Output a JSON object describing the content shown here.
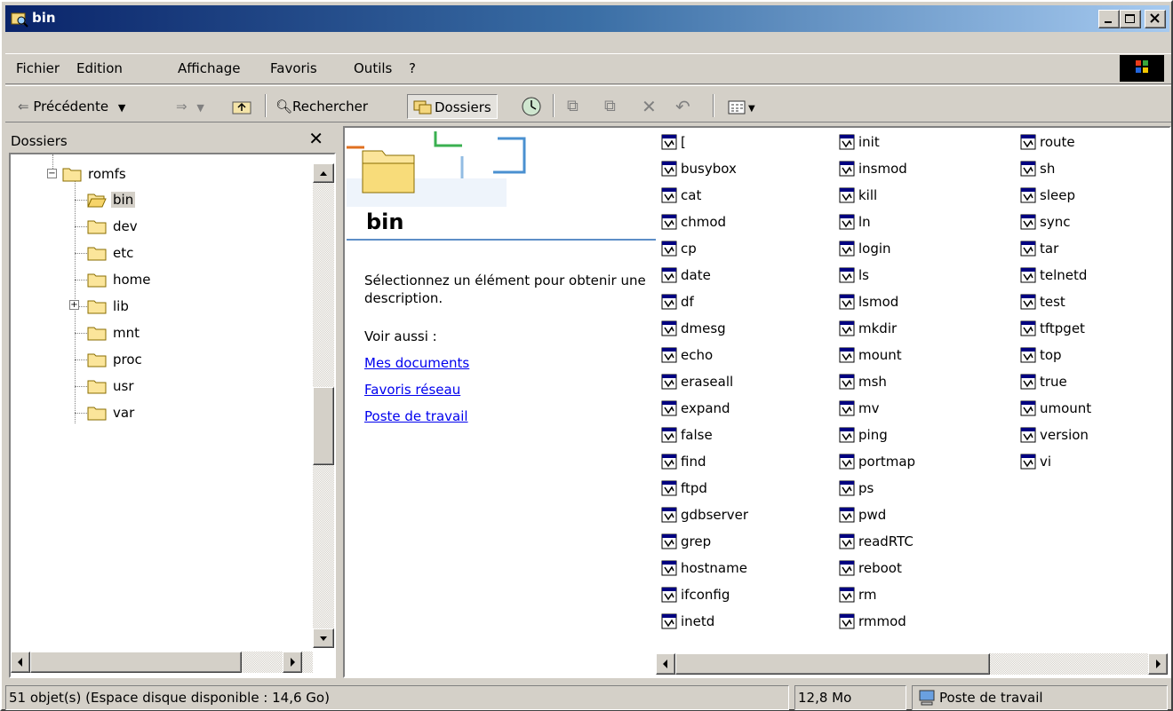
{
  "window": {
    "title": "bin"
  },
  "menu": [
    "Fichier",
    "Edition",
    "Affichage",
    "Favoris",
    "Outils",
    "?"
  ],
  "toolbar": {
    "back_label": "Précédente",
    "search_label": "Rechercher",
    "folders_label": "Dossiers"
  },
  "left_pane": {
    "header": "Dossiers",
    "tree": [
      {
        "label": "romfs",
        "expanded": true
      },
      {
        "label": "bin",
        "selected": true
      },
      {
        "label": "dev"
      },
      {
        "label": "etc"
      },
      {
        "label": "home"
      },
      {
        "label": "lib",
        "collapsed": true
      },
      {
        "label": "mnt"
      },
      {
        "label": "proc"
      },
      {
        "label": "usr"
      },
      {
        "label": "var"
      }
    ]
  },
  "webview": {
    "folder_title": "bin",
    "description": "Sélectionnez un élément pour obtenir une description.",
    "see_also": "Voir aussi :",
    "links": [
      "Mes documents",
      "Favoris réseau",
      "Poste de travail"
    ]
  },
  "files": {
    "col1": [
      "[",
      "busybox",
      "cat",
      "chmod",
      "cp",
      "date",
      "df",
      "dmesg",
      "echo",
      "eraseall",
      "expand",
      "false",
      "find",
      "ftpd",
      "gdbserver",
      "grep",
      "hostname",
      "ifconfig",
      "inetd"
    ],
    "col2": [
      "init",
      "insmod",
      "kill",
      "ln",
      "login",
      "ls",
      "lsmod",
      "mkdir",
      "mount",
      "msh",
      "mv",
      "ping",
      "portmap",
      "ps",
      "pwd",
      "readRTC",
      "reboot",
      "rm",
      "rmmod"
    ],
    "col3": [
      "route",
      "sh",
      "sleep",
      "sync",
      "tar",
      "telnetd",
      "test",
      "tftpget",
      "top",
      "true",
      "umount",
      "version",
      "vi"
    ]
  },
  "status": {
    "objects": "51 objet(s) (Espace disque disponible : 14,6 Go)",
    "size": "12,8 Mo",
    "zone": "Poste de travail"
  },
  "colors": {
    "title_gradient_start": "#0a246a",
    "title_gradient_end": "#a6caf0",
    "face": "#d4d0c8",
    "link": "#0000ee"
  }
}
